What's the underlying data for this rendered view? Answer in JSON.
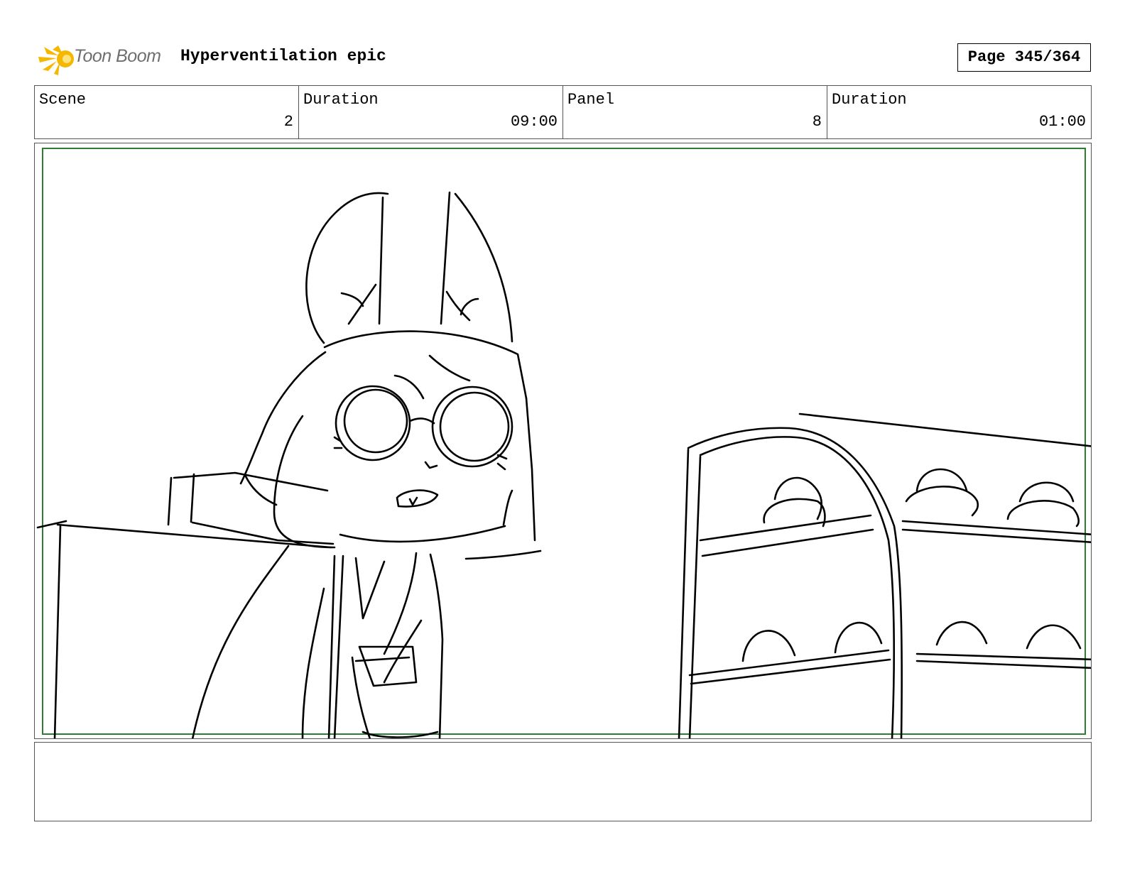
{
  "header": {
    "logo_text": "Toon Boom",
    "logo_colors": {
      "flame": "#f5b800",
      "text": "#6f6f6f"
    },
    "project_title": "Hyperventilation epic",
    "page_indicator": "Page 345/364"
  },
  "info": [
    {
      "label": "Scene",
      "value": "2"
    },
    {
      "label": "Duration",
      "value": "09:00"
    },
    {
      "label": "Panel",
      "value": "8"
    },
    {
      "label": "Duration",
      "value": "01:00"
    }
  ],
  "panel": {
    "safe_area_color": "#2e7d32",
    "drawing": "rough sketch: bunny-eared character with round glasses behind a counter, bakery display case with buns"
  },
  "notes": {
    "text": ""
  }
}
